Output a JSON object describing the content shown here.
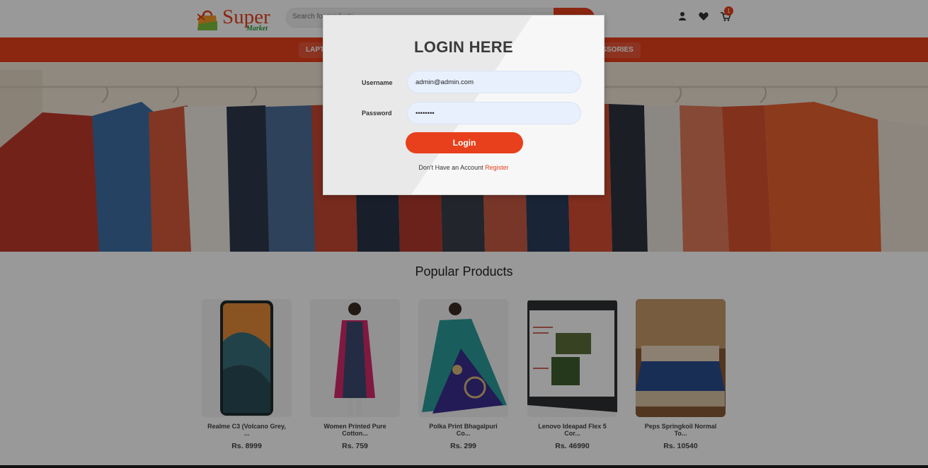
{
  "header": {
    "logo_word": "Super",
    "logo_sub": "Market",
    "search_placeholder": "Search for products",
    "search_button": "Search",
    "cart_count": "1"
  },
  "nav": {
    "items": [
      "LAPTOPS",
      "ACCESSORIES"
    ]
  },
  "popular": {
    "title": "Popular Products",
    "products": [
      {
        "name_line1": "Realme C3 (Volcano Grey,",
        "name_line2": "...",
        "price": "Rs. 8999"
      },
      {
        "name_line1": "Women Printed Pure",
        "name_line2": "Cotton...",
        "price": "Rs. 759"
      },
      {
        "name_line1": "Polka Print Bhagalpuri",
        "name_line2": "Co...",
        "price": "Rs. 299"
      },
      {
        "name_line1": "Lenovo Ideapad Flex 5",
        "name_line2": "Cor...",
        "price": "Rs. 46990"
      },
      {
        "name_line1": "Peps Springkoil Normal",
        "name_line2": "To...",
        "price": "Rs. 10540"
      }
    ]
  },
  "login": {
    "title": "LOGIN HERE",
    "username_label": "Username",
    "username_value": "admin@admin.com",
    "password_label": "Password",
    "password_value": "adminpas",
    "submit_label": "Login",
    "register_prompt": "Don't Have an Account",
    "register_link": "Register"
  },
  "colors": {
    "accent": "#e8401c",
    "logo_green": "#2a9d3a",
    "input_bg": "#e8f0fe"
  },
  "icons": [
    "user-icon",
    "heart-icon",
    "cart-icon"
  ]
}
